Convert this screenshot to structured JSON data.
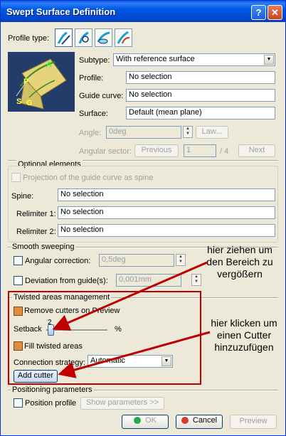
{
  "window": {
    "title": "Swept Surface Definition",
    "help_glyph": "?",
    "close_glyph": "✕"
  },
  "profile_type": {
    "label": "Profile type:",
    "icons": [
      "swept-line-icon",
      "swept-circle-icon",
      "swept-conic-icon",
      "swept-explicit-icon"
    ],
    "selected_index": 0
  },
  "form": {
    "subtype_label": "Subtype:",
    "subtype_value": "With reference surface",
    "profile_label": "Profile:",
    "profile_value": "No selection",
    "guide_curve_label": "Guide curve:",
    "guide_curve_value": "No selection",
    "surface_label": "Surface:",
    "surface_value": "Default (mean plane)",
    "angle_label": "Angle:",
    "angle_value": "0deg",
    "law_button": "Law...",
    "angular_sector_label": "Angular sector:",
    "previous_button": "Previous",
    "sector_value": "1",
    "sector_total": "/ 4",
    "next_button": "Next"
  },
  "preview_labels": {
    "a": "A",
    "p": "P",
    "s": "S",
    "g": "G"
  },
  "optional": {
    "header": "Optional elements",
    "projection_label": "Projection of the guide curve as spine",
    "spine_label": "Spine:",
    "spine_value": "No selection",
    "relimiter1_label": "Relimiter 1:",
    "relimiter1_value": "No selection",
    "relimiter2_label": "Relimiter 2:",
    "relimiter2_value": "No selection"
  },
  "smooth": {
    "header": "Smooth sweeping",
    "angular_label": "Angular correction:",
    "angular_value": "0,5deg",
    "deviation_label": "Deviation from guide(s):",
    "deviation_value": "0,001mm"
  },
  "twisted": {
    "header": "Twisted areas management",
    "remove_label": "Remove cutters on Preview",
    "setback_label": "Setback",
    "setback_value": "2",
    "setback_percent": 0.02,
    "setback_unit": "%",
    "fill_label": "Fill twisted areas",
    "strategy_label": "Connection strategy:",
    "strategy_value": "Automatic",
    "add_cutter_button": "Add cutter"
  },
  "positioning": {
    "header": "Positioning parameters",
    "position_label": "Position profile",
    "show_button": "Show parameters >>"
  },
  "footer": {
    "ok": "OK",
    "cancel": "Cancel",
    "preview": "Preview"
  },
  "annotations": {
    "callout_setback": [
      "hier ziehen um",
      "den Bereich zu",
      "vergößern"
    ],
    "callout_add_cutter": [
      "hier klicken um",
      "einen Cutter",
      "hinzuzufügen"
    ],
    "color": "#c00000"
  }
}
